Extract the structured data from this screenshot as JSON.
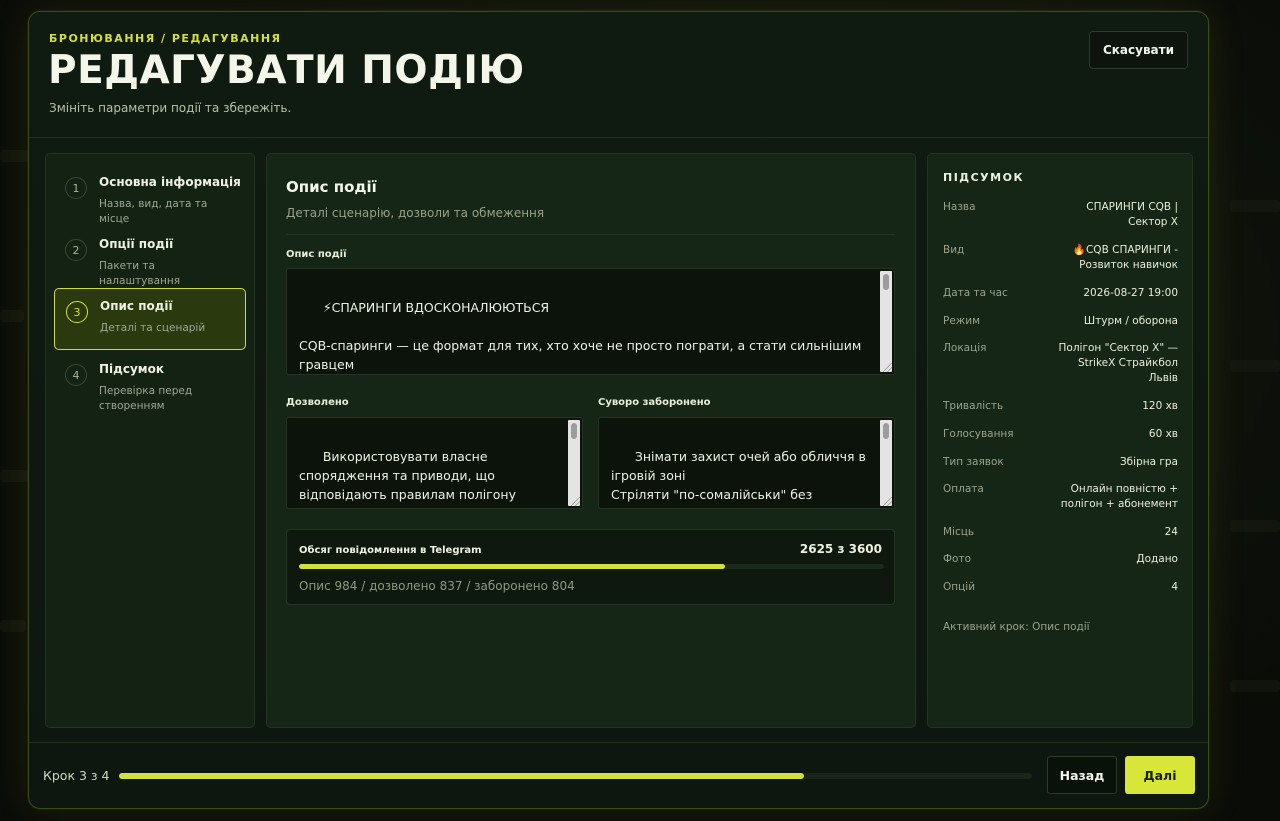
{
  "header": {
    "breadcrumb": "БРОНЮВАННЯ / РЕДАГУВАННЯ",
    "title": "РЕДАГУВАТИ ПОДІЮ",
    "subtitle": "Змініть параметри події та збережіть.",
    "cancel_label": "Скасувати"
  },
  "steps": [
    {
      "number": "1",
      "title": "Основна інформація",
      "desc": "Назва, вид, дата та місце",
      "active": false
    },
    {
      "number": "2",
      "title": "Опції події",
      "desc": "Пакети та налаштування",
      "active": false
    },
    {
      "number": "3",
      "title": "Опис події",
      "desc": "Деталі та сценарій",
      "active": true
    },
    {
      "number": "4",
      "title": "Підсумок",
      "desc": "Перевірка перед створенням",
      "active": false
    }
  ],
  "main": {
    "title": "Опис події",
    "subtitle": "Деталі сценарію, дозволи та обмеження",
    "description_label": "Опис події",
    "description_value": "⚡СПАРИНГИ ВДОСКОНАЛЮЮТЬСЯ\n\nCQB-спаринги — це формат для тих, хто хоче не просто пограти, а стати сильнішим гравцем",
    "allowed_label": "Дозволено",
    "allowed_value": "Використовувати власне спорядження та приводи, що відповідають правилам полігону\nВикористовувати радіозв'язок для",
    "forbidden_label": "Суворо заборонено",
    "forbidden_value": "Знімати захист очей або обличчя в ігровій зоні\nСтріляти \"по-сомалійськи\" без візуального контролю цілі",
    "telegram": {
      "label": "Обсяг повідомлення в Telegram",
      "count": "2625 з 3600",
      "fraction": 0.729,
      "breakdown": "Опис 984 / дозволено 837 / заборонено 804"
    }
  },
  "summary": {
    "title": "ПІДСУМОК",
    "rows": [
      {
        "key": "Назва",
        "value": "СПАРИНГИ CQB | Сектор Х"
      },
      {
        "key": "Вид",
        "value": "🔥CQB СПАРИНГИ - Розвиток навичок"
      },
      {
        "key": "Дата та час",
        "value": "2026-08-27 19:00"
      },
      {
        "key": "Режим",
        "value": "Штурм / оборона"
      },
      {
        "key": "Локація",
        "value": "Полігон \"Сектор Х\" — StrikeX Страйкбол Львів"
      },
      {
        "key": "Тривалість",
        "value": "120 хв"
      },
      {
        "key": "Голосування",
        "value": "60 хв"
      },
      {
        "key": "Тип заявок",
        "value": "Збірна гра"
      },
      {
        "key": "Оплата",
        "value": "Онлайн повністю + полігон + абонемент"
      },
      {
        "key": "Місць",
        "value": "24"
      },
      {
        "key": "Фото",
        "value": "Додано"
      },
      {
        "key": "Опцій",
        "value": "4"
      }
    ],
    "active_step": "Активний крок: Опис події"
  },
  "footer": {
    "step_counter": "Крок 3 з 4",
    "progress_fraction": 0.75,
    "back_label": "Назад",
    "next_label": "Далі"
  },
  "colors": {
    "accent": "#d4e03a",
    "background": "#0f1a10",
    "panel": "#152616"
  }
}
